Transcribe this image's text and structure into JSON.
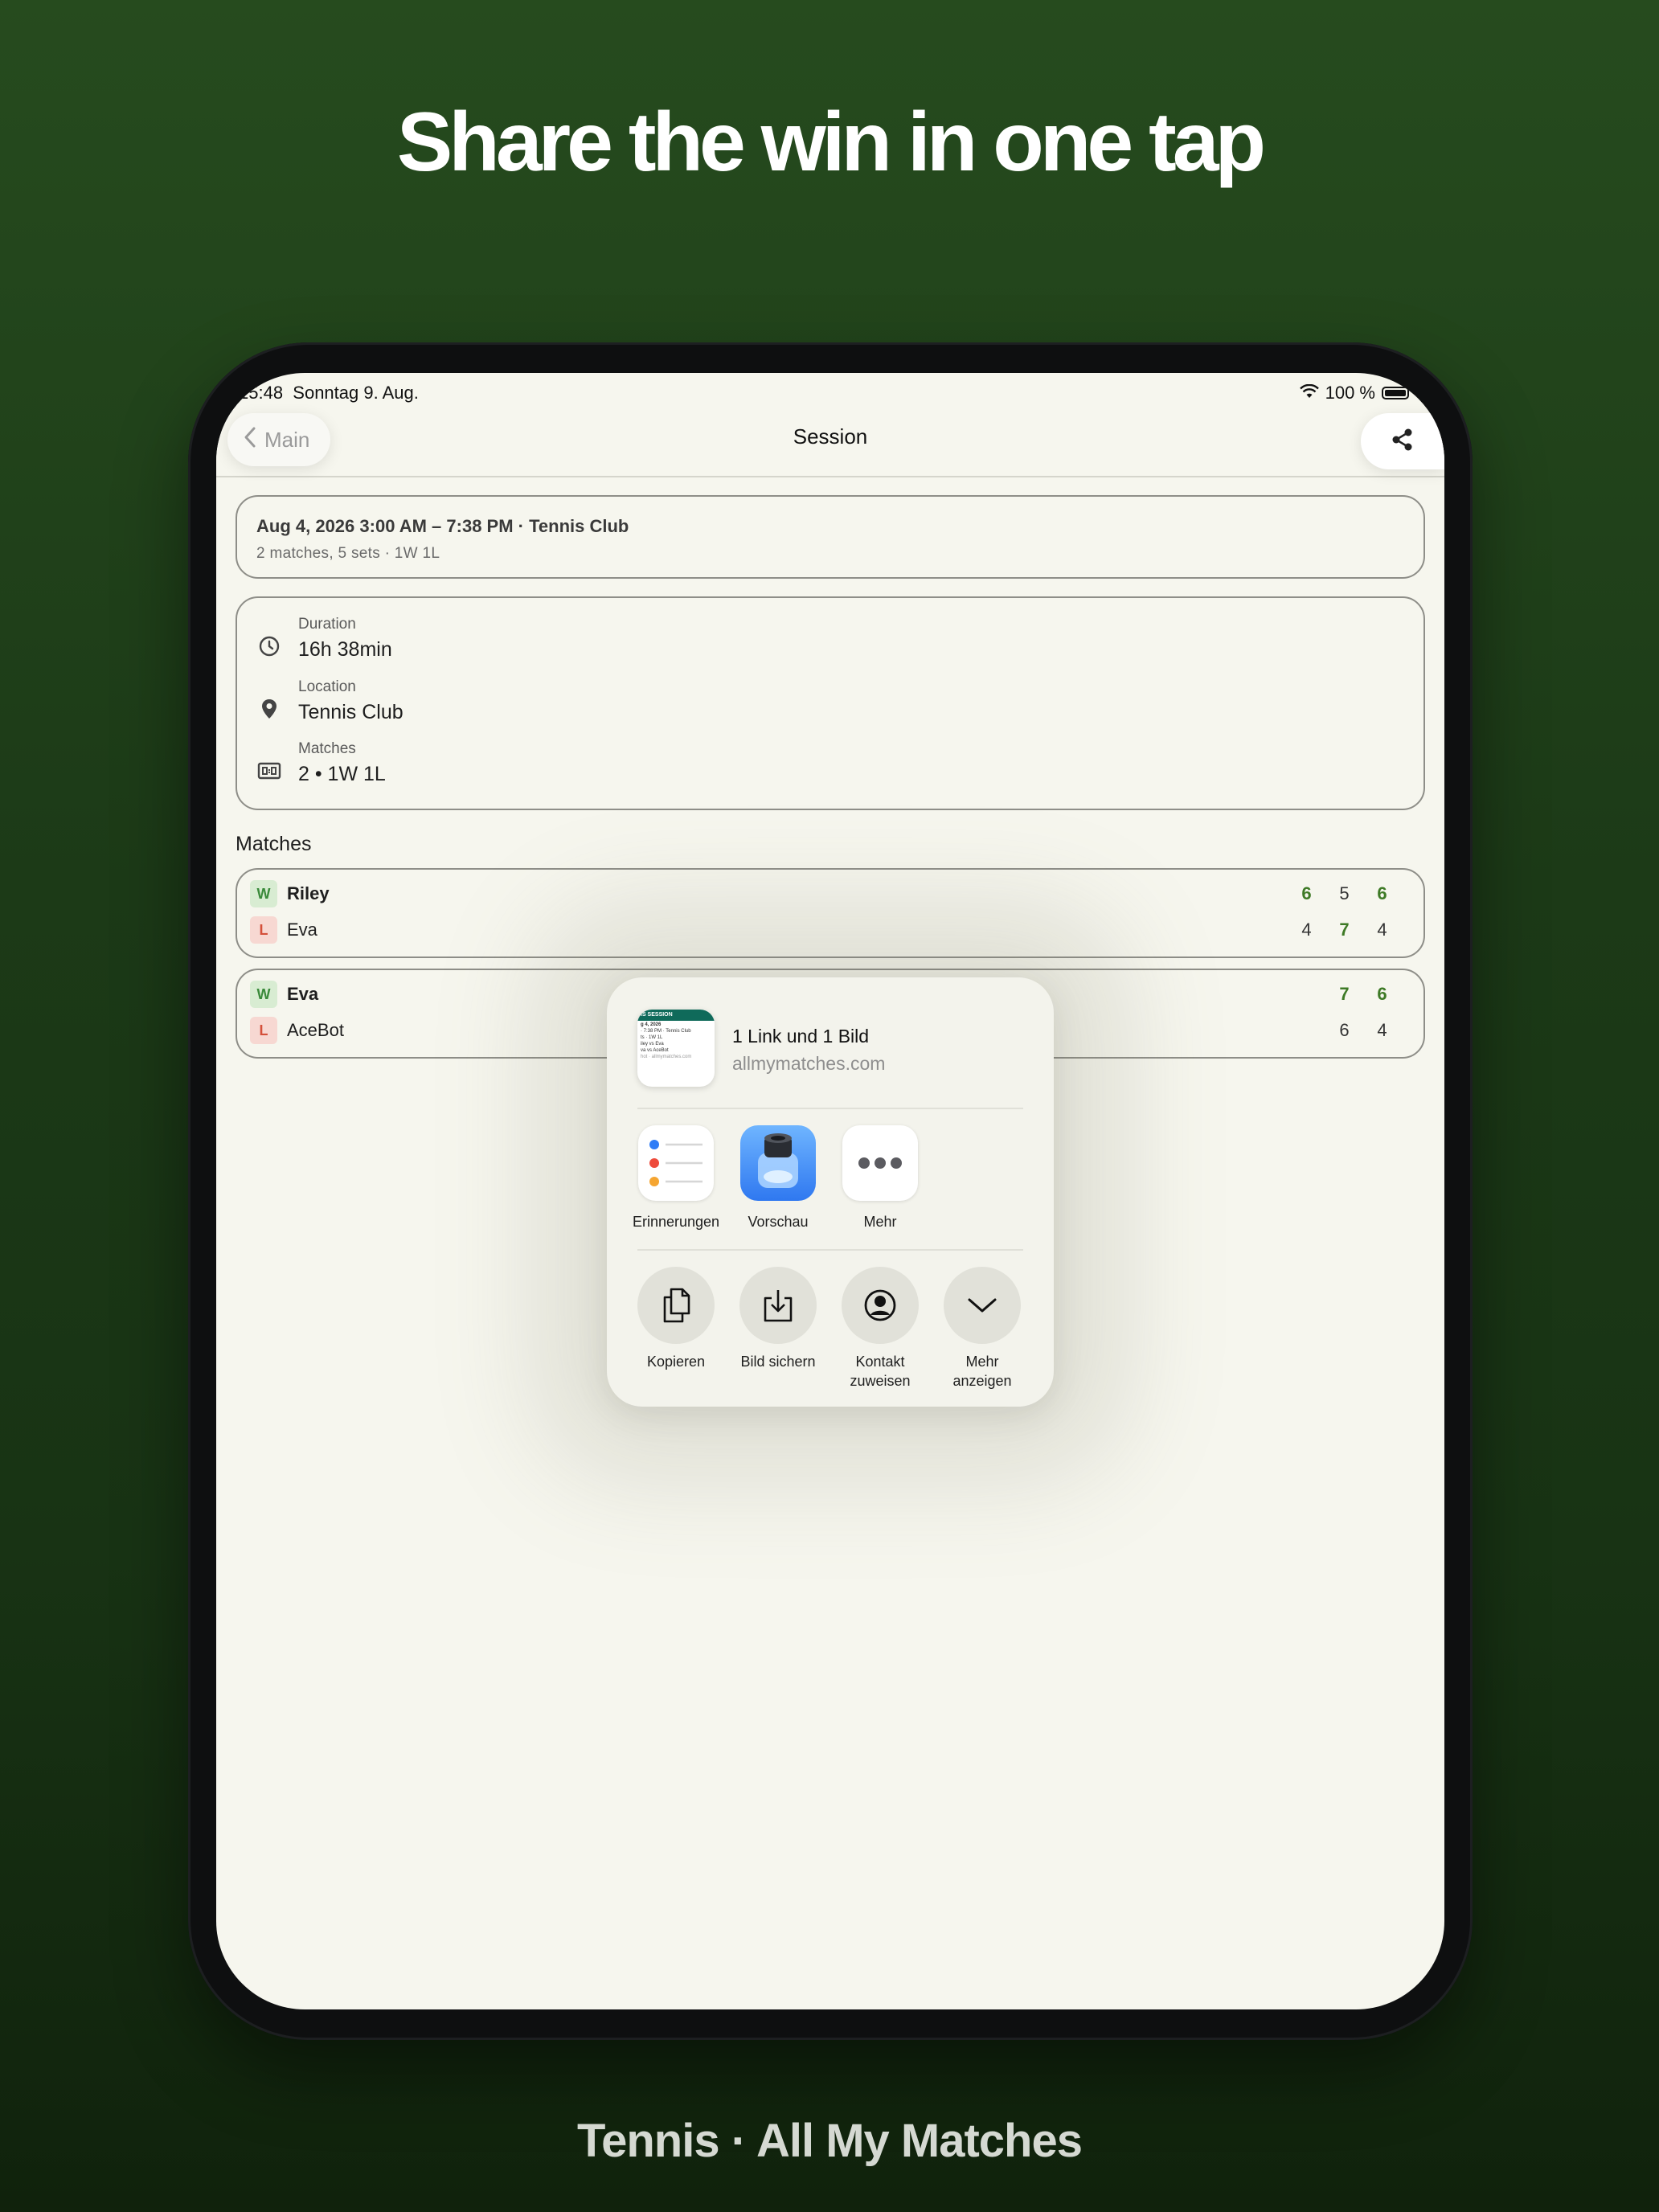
{
  "headline": "Share the win in one tap",
  "footer_caption": "Tennis · All My Matches",
  "status_bar": {
    "time_date": "15:48  Sonntag 9. Aug.",
    "battery": "100 %"
  },
  "nav": {
    "back_label": "Main",
    "title": "Session"
  },
  "summary": {
    "title": "Aug 4, 2026 3:00 AM – 7:38 PM · Tennis Club",
    "subtitle": "2 matches, 5 sets · 1W 1L"
  },
  "details": [
    {
      "icon": "clock-icon",
      "label": "Duration",
      "value": "16h 38min"
    },
    {
      "icon": "location-pin-icon",
      "label": "Location",
      "value": "Tennis Club"
    },
    {
      "icon": "scoreboard-icon",
      "label": "Matches",
      "value": "2 • 1W 1L"
    }
  ],
  "matches_section_title": "Matches",
  "matches": [
    {
      "players": [
        {
          "result": "W",
          "name": "Riley",
          "scores": [
            "6",
            "5",
            "6"
          ],
          "won_sets": [
            true,
            false,
            true
          ]
        },
        {
          "result": "L",
          "name": "Eva",
          "scores": [
            "4",
            "7",
            "4"
          ],
          "won_sets": [
            false,
            true,
            false
          ]
        }
      ]
    },
    {
      "players": [
        {
          "result": "W",
          "name": "Eva",
          "scores": [
            "7",
            "6"
          ],
          "won_sets": [
            true,
            true
          ]
        },
        {
          "result": "L",
          "name": "AceBot",
          "scores": [
            "6",
            "4"
          ],
          "won_sets": [
            false,
            false
          ]
        }
      ]
    }
  ],
  "share_sheet": {
    "title": "1 Link und 1 Bild",
    "url": "allmymatches.com",
    "thumbnail": {
      "header": "IS SESSION",
      "lines": [
        "g 4, 2026",
        "· 7:38 PM · Tennis Club",
        "ts · 1W 1L",
        "iley vs Eva",
        "va vs AceBot",
        "hot · allmymatches.com"
      ]
    },
    "apps": [
      {
        "icon": "reminders-icon",
        "label": "Erinnerungen"
      },
      {
        "icon": "preview-icon",
        "label": "Vorschau"
      },
      {
        "icon": "more-apps-icon",
        "label": "Mehr"
      }
    ],
    "actions": [
      {
        "icon": "copy-icon",
        "label": "Kopieren"
      },
      {
        "icon": "save-image-icon",
        "label": "Bild sichern"
      },
      {
        "icon": "assign-contact-icon",
        "label": "Kontakt zuweisen"
      },
      {
        "icon": "chevron-down-icon",
        "label": "Mehr anzeigen"
      }
    ]
  },
  "colors": {
    "background_green": "#1c3a17",
    "screen_bg": "#f6f6ee",
    "win_green": "#3e7a26",
    "badge_w_bg": "#d8ecd2",
    "badge_l_bg": "#f7d8d2",
    "thumbnail_header": "#0f6a5a"
  }
}
